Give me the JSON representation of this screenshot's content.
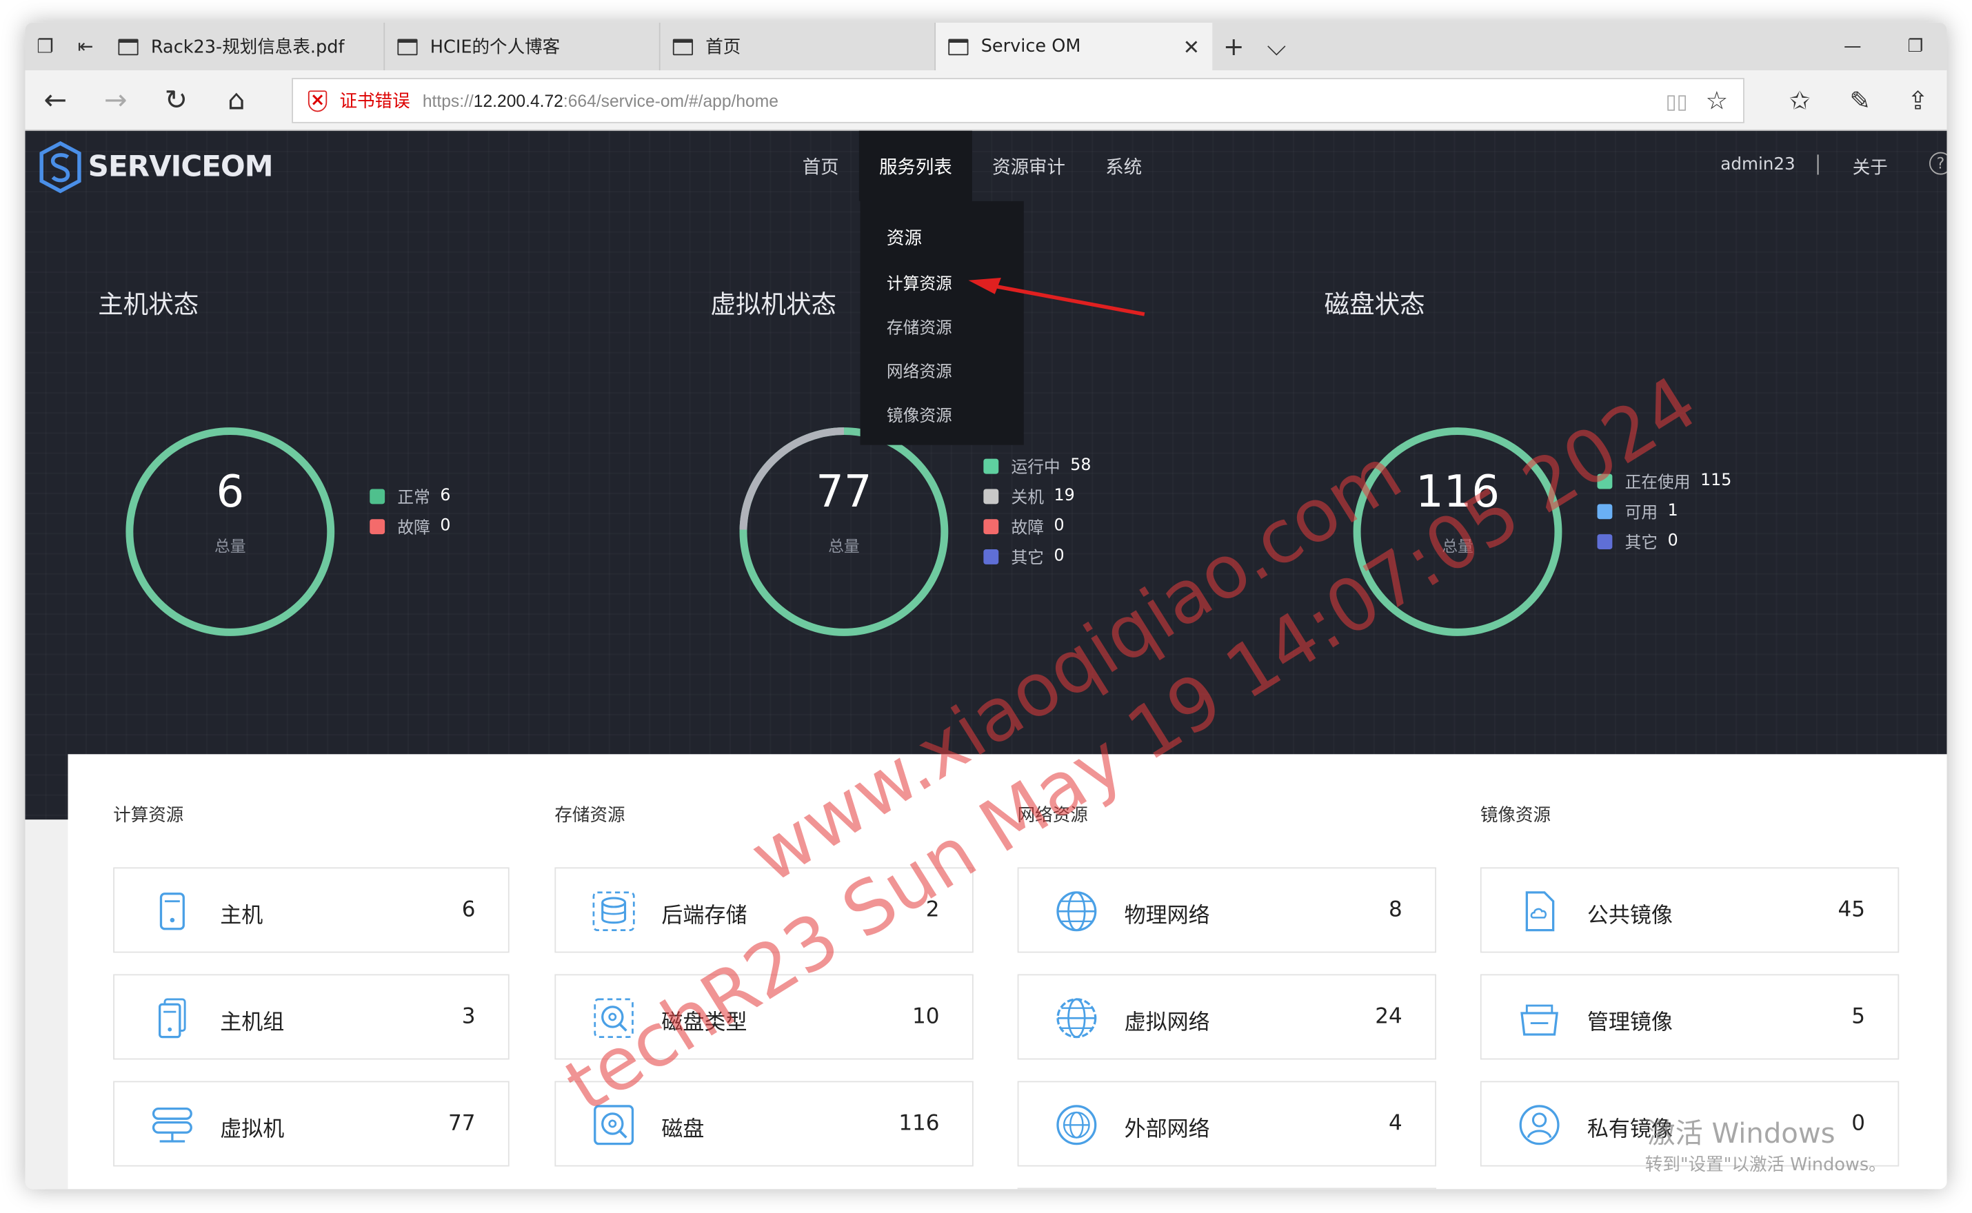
{
  "browser": {
    "tabs": [
      {
        "label": "Rack23-规划信息表.pdf",
        "active": false
      },
      {
        "label": "HCIE的个人博客",
        "active": false
      },
      {
        "label": "首页",
        "active": false
      },
      {
        "label": "Service OM",
        "active": true
      }
    ],
    "cert_error": "证书错误",
    "url_scheme": "https://",
    "url_host": "12.200.4.72",
    "url_rest": ":664/service-om/#/app/home"
  },
  "app": {
    "logo_text": "SERVICEOM",
    "nav": [
      "首页",
      "服务列表",
      "资源审计",
      "系统"
    ],
    "user": "admin23",
    "about": "关于",
    "help": "?",
    "dropdown": {
      "header": "资源",
      "items": [
        "计算资源",
        "存储资源",
        "网络资源",
        "镜像资源"
      ]
    }
  },
  "status": {
    "host": {
      "title": "主机状态",
      "total": "6",
      "total_label": "总量",
      "legend": [
        {
          "label": "正常",
          "value": "6",
          "color": "#4fc08d"
        },
        {
          "label": "故障",
          "value": "0",
          "color": "#f46b6b"
        }
      ]
    },
    "vm": {
      "title": "虚拟机状态",
      "total": "77",
      "total_label": "总量",
      "legend": [
        {
          "label": "运行中",
          "value": "58",
          "color": "#5fd0a0"
        },
        {
          "label": "关机",
          "value": "19",
          "color": "#c8c8c8"
        },
        {
          "label": "故障",
          "value": "0",
          "color": "#f46b6b"
        },
        {
          "label": "其它",
          "value": "0",
          "color": "#5f6fd6"
        }
      ]
    },
    "disk": {
      "title": "磁盘状态",
      "total": "116",
      "total_label": "总量",
      "legend": [
        {
          "label": "正在使用",
          "value": "115",
          "color": "#5fd0a0"
        },
        {
          "label": "可用",
          "value": "1",
          "color": "#6ab0f5"
        },
        {
          "label": "其它",
          "value": "0",
          "color": "#5f6fd6"
        }
      ]
    }
  },
  "categories": {
    "compute": {
      "title": "计算资源",
      "items": [
        {
          "label": "主机",
          "value": "6",
          "icon": "host-icon"
        },
        {
          "label": "主机组",
          "value": "3",
          "icon": "host-group-icon"
        },
        {
          "label": "虚拟机",
          "value": "77",
          "icon": "vm-icon"
        }
      ]
    },
    "storage": {
      "title": "存储资源",
      "items": [
        {
          "label": "后端存储",
          "value": "2",
          "icon": "backend-storage-icon"
        },
        {
          "label": "磁盘类型",
          "value": "10",
          "icon": "disk-type-icon"
        },
        {
          "label": "磁盘",
          "value": "116",
          "icon": "disk-icon"
        }
      ]
    },
    "network": {
      "title": "网络资源",
      "items": [
        {
          "label": "物理网络",
          "value": "8",
          "icon": "globe-icon"
        },
        {
          "label": "虚拟网络",
          "value": "24",
          "icon": "globe-icon"
        },
        {
          "label": "外部网络",
          "value": "4",
          "icon": "globe-icon"
        }
      ]
    },
    "image": {
      "title": "镜像资源",
      "items": [
        {
          "label": "公共镜像",
          "value": "45",
          "icon": "public-image-icon"
        },
        {
          "label": "管理镜像",
          "value": "5",
          "icon": "managed-image-icon"
        },
        {
          "label": "私有镜像",
          "value": "0",
          "icon": "private-image-icon"
        }
      ]
    }
  },
  "watermark": {
    "line1": "www.xiaoqiqiao.com",
    "line2": "techR23 Sun May 19 14:07:05 2024"
  },
  "activation": {
    "line1": "激活 Windows",
    "line2": "转到\"设置\"以激活 Windows。"
  }
}
